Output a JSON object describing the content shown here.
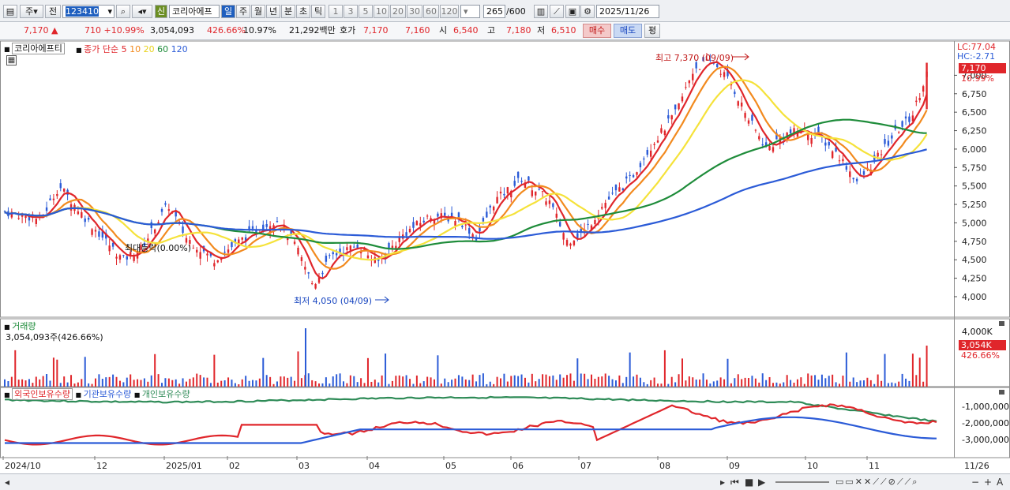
{
  "toolbar": {
    "type_a": "주",
    "type_b": "전",
    "code": "123410",
    "badge_new": "신",
    "name": "코리아에프",
    "periods": [
      "일",
      "주",
      "월",
      "년",
      "분",
      "초",
      "틱"
    ],
    "minutes": [
      "1",
      "3",
      "5",
      "10",
      "20",
      "30",
      "60",
      "120"
    ],
    "count_cur": "265",
    "count_total": "/600",
    "date": "2025/11/26"
  },
  "quote": {
    "price": "7,170",
    "arrow": "▲",
    "change": "710",
    "change_pct": "+10.99%",
    "volume": "3,054,093",
    "vol_ratio": "426.66%",
    "turnover": "10.97%",
    "amount": "21,292백만",
    "ask_label": "호가",
    "ask1": "7,170",
    "ask2": "7,160",
    "open_label": "시",
    "open": "6,540",
    "high_label": "고",
    "high": "7,180",
    "low_label": "저",
    "low": "6,510",
    "buy": "매수",
    "sell": "매도",
    "avg": "평"
  },
  "price_pane": {
    "title": "코리아에프티",
    "ma_prefix": "종가 단순",
    "ma": [
      {
        "label": "5",
        "color": "#e0262b"
      },
      {
        "label": "10",
        "color": "#f28a1e"
      },
      {
        "label": "20",
        "color": "#f5e23a"
      },
      {
        "label": "60",
        "color": "#1e8c3a"
      },
      {
        "label": "120",
        "color": "#2b5bd7"
      }
    ],
    "lc": "LC:77.04",
    "hc": "HC:-2.71",
    "cur_price": "7,170",
    "cur_pct": "10.99%",
    "max_label": "최고 7,370 (09/09)",
    "min_label": "최저 4,050 (04/09)",
    "mid_label": "최대등락(0.00%)",
    "y_ticks": [
      "7,000",
      "6,750",
      "6,500",
      "6,250",
      "6,000",
      "5,750",
      "5,500",
      "5,250",
      "5,000",
      "4,750",
      "4,500",
      "4,250",
      "4,000"
    ]
  },
  "volume_pane": {
    "title": "거래량",
    "subtitle": "3,054,093주(426.66%)",
    "cur": "3,054K",
    "cur_pct": "426.66%",
    "tick": "4,000K"
  },
  "holders_pane": {
    "series": [
      {
        "label": "외국인보유수량",
        "color": "#e0262b"
      },
      {
        "label": "기관보유수량",
        "color": "#2b5bd7"
      },
      {
        "label": "개인보유수량",
        "color": "#2e8b57"
      }
    ],
    "y_ticks": [
      "-1,000,000",
      "-2,000,000",
      "-3,000,000"
    ]
  },
  "x_axis": [
    "2024/10",
    "12",
    "2025/01",
    "02",
    "03",
    "04",
    "05",
    "06",
    "07",
    "08",
    "09",
    "10",
    "11"
  ],
  "x_right": "11/26"
}
